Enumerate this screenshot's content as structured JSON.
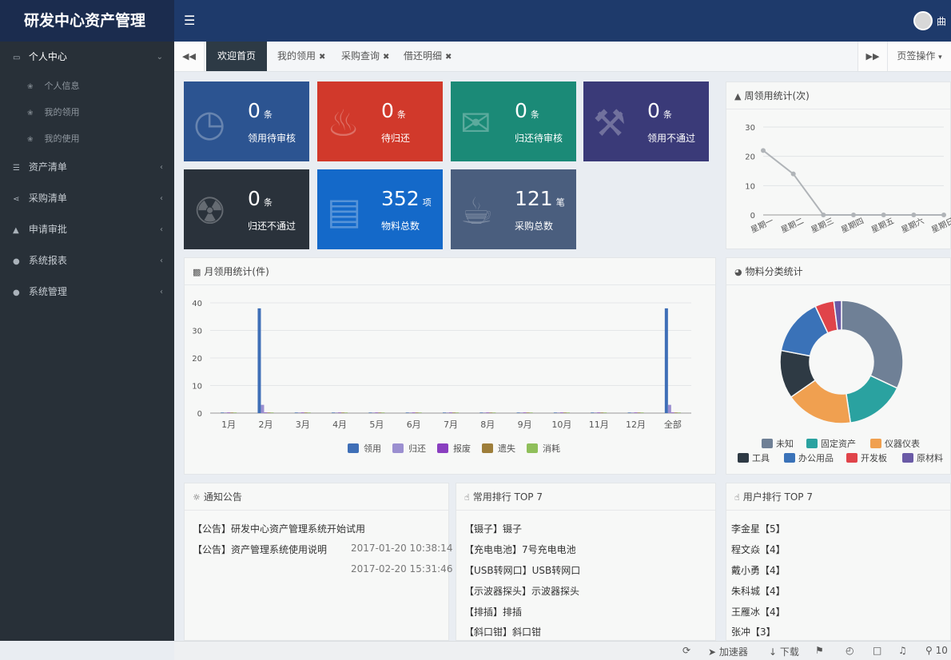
{
  "brand": "研发中心资产管理",
  "user": {
    "name_partial": "曲"
  },
  "sidebar": {
    "items": [
      {
        "label": "个人中心",
        "icon": "monitor-icon",
        "open": true,
        "children": [
          {
            "label": "个人信息"
          },
          {
            "label": "我的领用"
          },
          {
            "label": "我的使用"
          }
        ]
      },
      {
        "label": "资产清单",
        "icon": "list-icon"
      },
      {
        "label": "采购清单",
        "icon": "share-icon"
      },
      {
        "label": "申请审批",
        "icon": "area-chart-icon"
      },
      {
        "label": "系统报表",
        "icon": "globe-icon"
      },
      {
        "label": "系统管理",
        "icon": "globe-icon"
      }
    ]
  },
  "tabs": [
    {
      "label": "欢迎首页",
      "active": true
    },
    {
      "label": "我的领用",
      "closable": true
    },
    {
      "label": "采购查询",
      "closable": true
    },
    {
      "label": "借还明细",
      "closable": true
    }
  ],
  "page_ops_label": "页签操作",
  "cards": [
    {
      "value": "0",
      "unit": "条",
      "label": "领用待审核",
      "color": "#2c5491",
      "icon": "clock-icon"
    },
    {
      "value": "0",
      "unit": "条",
      "label": "待归还",
      "color": "#d1392b",
      "icon": "bell-icon"
    },
    {
      "value": "0",
      "unit": "条",
      "label": "归还待审核",
      "color": "#1b8a77",
      "icon": "envelope-icon"
    },
    {
      "value": "0",
      "unit": "条",
      "label": "领用不通过",
      "color": "#3a3a78",
      "icon": "gavel-icon"
    },
    {
      "value": "0",
      "unit": "条",
      "label": "归还不通过",
      "color": "#2a323b",
      "icon": "cart-icon"
    },
    {
      "value": "352",
      "unit": "项",
      "label": "物料总数",
      "color": "#1469c9",
      "icon": "file-icon"
    },
    {
      "value": "121",
      "unit": "笔",
      "label": "采购总数",
      "color": "#4a5e7e",
      "icon": "cup-icon"
    }
  ],
  "weekly": {
    "title": "周领用统计(次)",
    "chart_data": {
      "type": "line",
      "categories": [
        "星期一",
        "星期二",
        "星期三",
        "星期四",
        "星期五",
        "星期六",
        "星期日"
      ],
      "values": [
        22,
        14,
        0,
        0,
        0,
        0,
        0
      ],
      "ylim": [
        0,
        30
      ],
      "yticks": [
        0,
        10,
        20,
        30
      ],
      "color": "#b0b4b8"
    }
  },
  "monthly": {
    "title": "月领用统计(件)",
    "chart_data": {
      "type": "bar",
      "categories": [
        "1月",
        "2月",
        "3月",
        "4月",
        "5月",
        "6月",
        "7月",
        "8月",
        "9月",
        "10月",
        "11月",
        "12月",
        "全部"
      ],
      "series": [
        {
          "name": "领用",
          "color": "#3f6fb7",
          "values": [
            0,
            38,
            0,
            0,
            0,
            0,
            0,
            0,
            0,
            0,
            0,
            0,
            38
          ]
        },
        {
          "name": "归还",
          "color": "#9b8fd0",
          "values": [
            0,
            3,
            0,
            0,
            0,
            0,
            0,
            0,
            0,
            0,
            0,
            0,
            3
          ]
        },
        {
          "name": "报废",
          "color": "#8a3fc0",
          "values": [
            0,
            0,
            0,
            0,
            0,
            0,
            0,
            0,
            0,
            0,
            0,
            0,
            0
          ]
        },
        {
          "name": "遗失",
          "color": "#9e7e3a",
          "values": [
            0,
            0,
            0,
            0,
            0,
            0,
            0,
            0,
            0,
            0,
            0,
            0,
            0
          ]
        },
        {
          "name": "消耗",
          "color": "#8fbf5a",
          "values": [
            0,
            0,
            0,
            0,
            0,
            0,
            0,
            0,
            0,
            0,
            0,
            0,
            0
          ]
        }
      ],
      "ylim": [
        0,
        40
      ],
      "yticks": [
        0,
        10,
        20,
        30,
        40
      ],
      "legend": "bottom"
    }
  },
  "category": {
    "title": "物料分类统计",
    "chart_data": {
      "type": "pie",
      "labels": [
        "未知",
        "固定资产",
        "仪器仪表",
        "工具",
        "办公用品",
        "开发板",
        "原材料"
      ],
      "colors": [
        "#6f8096",
        "#2aa2a0",
        "#f0a050",
        "#2e3a44",
        "#3a72b8",
        "#e0444a",
        "#6a5aa6"
      ],
      "values": [
        96,
        47,
        53,
        38,
        45,
        15,
        6
      ],
      "donut": true,
      "legend": "bottom"
    }
  },
  "notice": {
    "title": "通知公告",
    "items": [
      {
        "text": "【公告】研发中心资产管理系统开始试用",
        "time": "2017-01-20 10:38:14"
      },
      {
        "text": "【公告】资产管理系统使用说明",
        "time": "2017-02-20 15:31:46"
      }
    ]
  },
  "top_items": {
    "title": "常用排行 TOP 7",
    "items": [
      "【镊子】镊子",
      "【充电电池】7号充电电池",
      "【USB转网口】USB转网口",
      "【示波器探头】示波器探头",
      "【排插】排插",
      "【斜口钳】斜口钳"
    ]
  },
  "top_users": {
    "title": "用户排行 TOP 7",
    "items": [
      "李金星【5】",
      "程文焱【4】",
      "戴小勇【4】",
      "朱科城【4】",
      "王雁冰【4】",
      "张冲【3】"
    ]
  },
  "statusbar": {
    "accelerator": "加速器",
    "download": "下载",
    "zoom": "10"
  }
}
